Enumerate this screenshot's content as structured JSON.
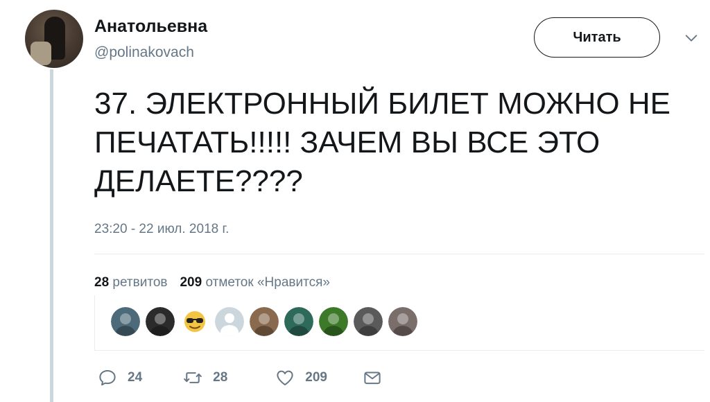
{
  "tweet": {
    "display_name": "Анатольевна",
    "screen_name": "@polinakovach",
    "follow_label": "Читать",
    "text": "37. ЭЛЕКТРОННЫЙ БИЛЕТ МОЖНО НЕ ПЕЧАТАТЬ!!!!! ЗАЧЕМ ВЫ ВСЕ ЭТО ДЕЛАЕТЕ????",
    "timestamp": "23:20 - 22 июл. 2018 г."
  },
  "stats": {
    "retweets_count": "28",
    "retweets_label": "ретвитов",
    "likes_count": "209",
    "likes_label": "отметок «Нравится»"
  },
  "likers": [
    {
      "icon": "avatar-photo",
      "color": "#4c6a7a"
    },
    {
      "icon": "avatar-photo",
      "color": "#2b2b2b"
    },
    {
      "icon": "sunglasses-emoji-icon",
      "color": "#f4c542"
    },
    {
      "icon": "default-avatar-icon",
      "color": "#ccd6dd"
    },
    {
      "icon": "avatar-photo",
      "color": "#8a6a4e"
    },
    {
      "icon": "avatar-photo",
      "color": "#2e6a5a"
    },
    {
      "icon": "avatar-photo",
      "color": "#3c7a2a"
    },
    {
      "icon": "avatar-photo",
      "color": "#5a5a5a"
    },
    {
      "icon": "avatar-photo",
      "color": "#7a6e6a"
    }
  ],
  "actions": {
    "reply_count": "24",
    "retweet_count": "28",
    "like_count": "209"
  },
  "colors": {
    "text": "#14171a",
    "secondary": "#657786",
    "thread_line": "#ccd6dd"
  }
}
